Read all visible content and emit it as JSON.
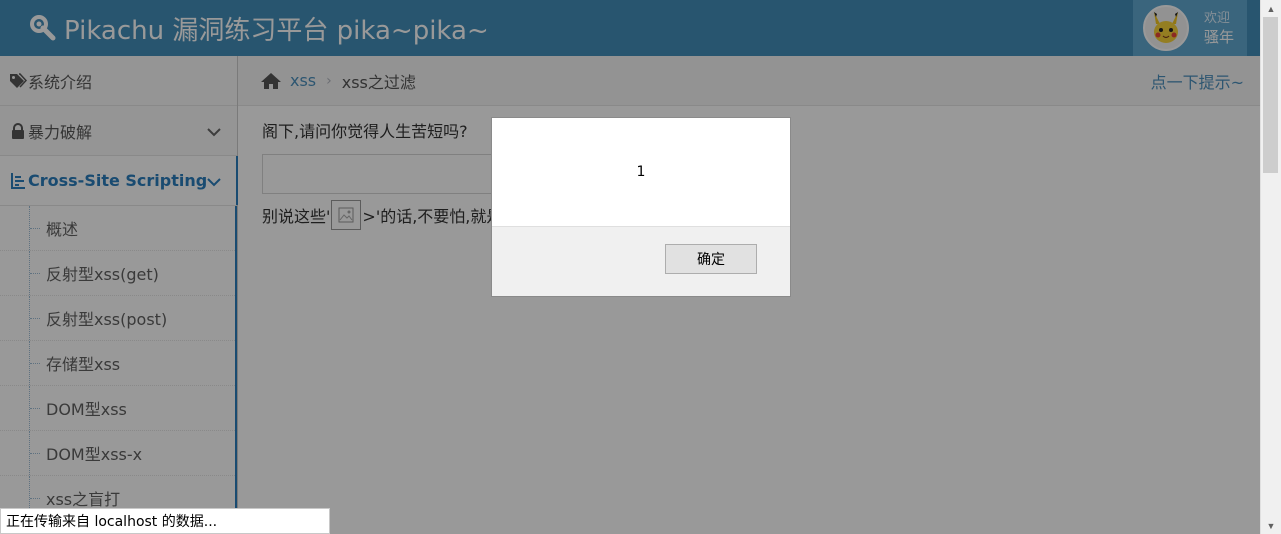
{
  "header": {
    "title": "Pikachu 漏洞练习平台 pika~pika~",
    "welcome": "欢迎",
    "username": "骚年"
  },
  "sidebar": {
    "items": [
      {
        "label": "系统介绍",
        "icon": "tags-icon"
      },
      {
        "label": "暴力破解",
        "icon": "lock-icon"
      },
      {
        "label": "Cross-Site Scripting",
        "icon": "list-tree-icon"
      }
    ],
    "sub_items": [
      "概述",
      "反射型xss(get)",
      "反射型xss(post)",
      "存储型xss",
      "DOM型xss",
      "DOM型xss-x",
      "xss之盲打"
    ]
  },
  "breadcrumb": {
    "link": "xss",
    "separator": "›",
    "current": "xss之过滤",
    "hint": "点一下提示~"
  },
  "content": {
    "question": "阁下,请问你觉得人生苦短吗?",
    "output_prefix": "别说这些'",
    "output_suffix": ">'的话,不要怕,就是"
  },
  "dialog": {
    "message": "1",
    "ok_label": "确定"
  },
  "status_bar": {
    "text": "正在传输来自 localhost 的数据..."
  },
  "colors": {
    "header_bg": "#438eb9",
    "accent": "#2b7dbc"
  }
}
